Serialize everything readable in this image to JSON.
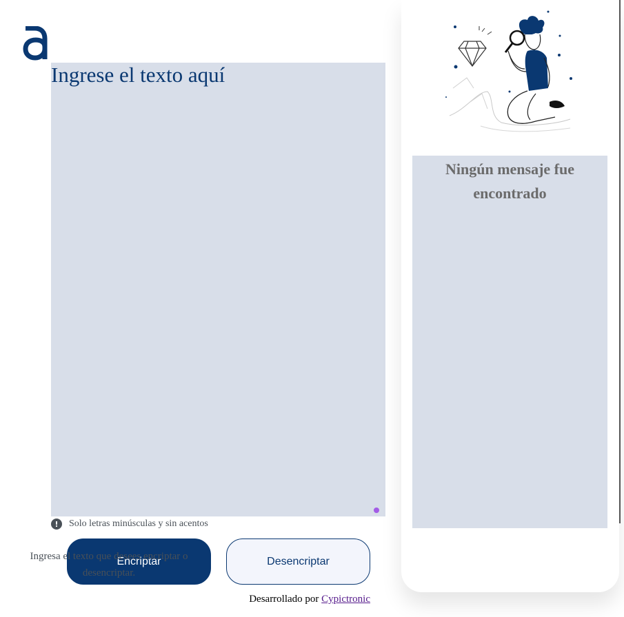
{
  "brand": {
    "logo_icon": "alura-a-logo-icon",
    "color": "#0a3871"
  },
  "input": {
    "placeholder": "Ingrese el texto aquí",
    "value": ""
  },
  "hint": {
    "icon": "exclamation-circle-icon",
    "text": "Solo letras minúsculas y sin acentos"
  },
  "buttons": {
    "encrypt_label": "Encriptar",
    "decrypt_label": "Desencriptar"
  },
  "footer": {
    "prefix": "Desarrollado por",
    "link_text": "Cypictronic"
  },
  "output": {
    "illustration": "boy-with-magnifying-glass-illustration",
    "title": "Ningún mensaje fue encontrado",
    "instructions": "Ingresa el texto que desees encriptar o desencriptar."
  },
  "colors": {
    "primary": "#0a3871",
    "panel_bg": "#d8dee9",
    "secondary_button_bg": "#f3f5fc",
    "muted_text": "#495057"
  }
}
